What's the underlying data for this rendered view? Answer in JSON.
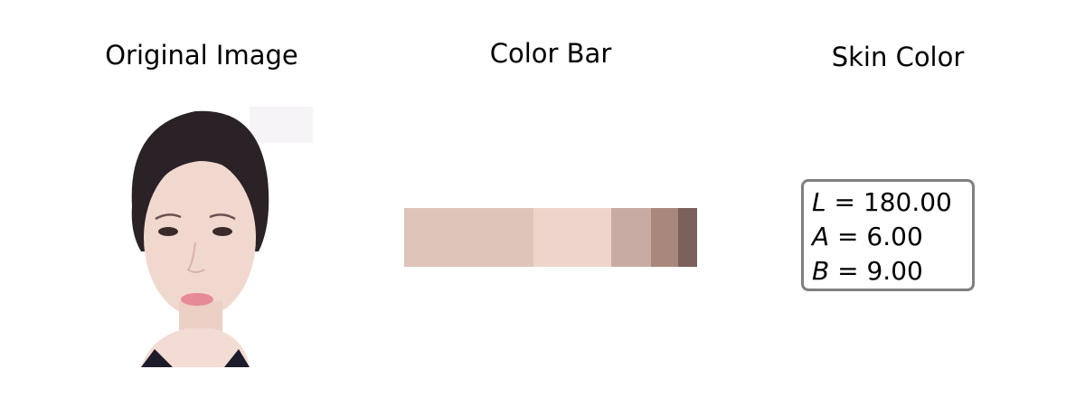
{
  "panels": {
    "original": {
      "title": "Original Image"
    },
    "colorbar": {
      "title": "Color Bar",
      "segments": [
        {
          "color": "#dfc4b9",
          "fraction": 0.441
        },
        {
          "color": "#eed5cc",
          "fraction": 0.265
        },
        {
          "color": "#c8aba3",
          "fraction": 0.136
        },
        {
          "color": "#a9877d",
          "fraction": 0.093
        },
        {
          "color": "#7b615c",
          "fraction": 0.065
        }
      ]
    },
    "skin": {
      "title": "Skin Color",
      "lines": [
        {
          "var": "L",
          "value": "180.00"
        },
        {
          "var": "A",
          "value": "6.00"
        },
        {
          "var": "B",
          "value": "9.00"
        }
      ]
    }
  }
}
